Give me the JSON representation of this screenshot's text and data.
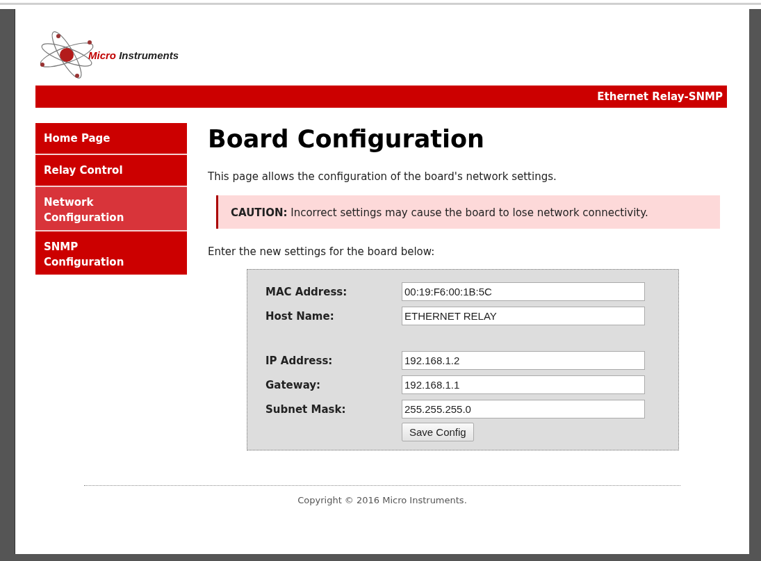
{
  "brand": {
    "name_part_1": "Micro",
    "name_part_2": "Instruments"
  },
  "banner": "Ethernet Relay-SNMP",
  "sidebar": {
    "items": [
      {
        "label": "Home Page",
        "selected": false
      },
      {
        "label": "Relay Control",
        "selected": false
      },
      {
        "label": "Network Configuration",
        "selected": true
      },
      {
        "label": "SNMP Configuration",
        "selected": false
      }
    ]
  },
  "heading": "Board Configuration",
  "intro": "This page allows the configuration of the board's network settings.",
  "caution": "**CAUTION:** Incorrect settings may cause the board to lose network connectivity.",
  "form": {
    "prompt": "Enter the new settings for the board below:",
    "field_groups": [
      [
        {
          "label": "MAC Address:",
          "value": "00:19:F6:00:1B:5C"
        },
        {
          "label": "Host Name:",
          "value": "ETHERNET RELAY"
        }
      ],
      [
        {
          "label": "IP Address:",
          "value": "192.168.1.2"
        },
        {
          "label": "Gateway:",
          "value": "192.168.1.1"
        },
        {
          "label": "Subnet Mask:",
          "value": "255.255.255.0"
        }
      ]
    ],
    "button": "Save Config"
  },
  "footer": "Copyright © 2016 Micro Instruments."
}
